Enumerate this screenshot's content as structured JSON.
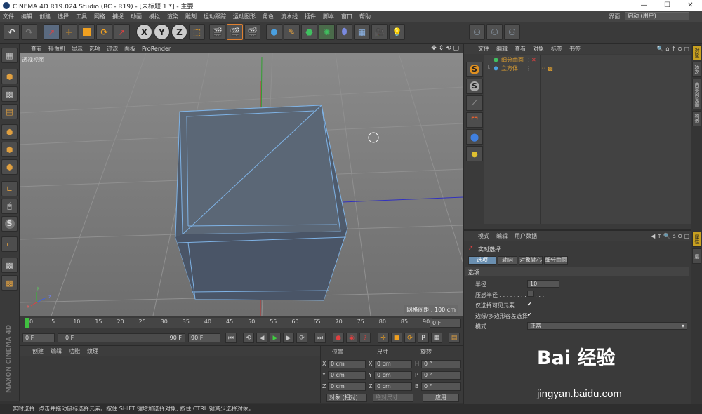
{
  "titlebar": {
    "title": "CINEMA 4D R19.024 Studio (RC - R19) - [未标题 1 *] - 主要",
    "min": "—",
    "max": "☐",
    "close": "✕"
  },
  "menubar": {
    "items": [
      "文件",
      "编辑",
      "创建",
      "选择",
      "工具",
      "网格",
      "捕捉",
      "动画",
      "模拟",
      "渲染",
      "雕刻",
      "运动跟踪",
      "运动图形",
      "角色",
      "流水线",
      "插件",
      "脚本",
      "窗口",
      "帮助"
    ],
    "layout_label": "界面:",
    "layout_value": "启动 (用户)"
  },
  "toolbar": {
    "axis_x": "X",
    "axis_y": "Y",
    "axis_z": "Z"
  },
  "viewport": {
    "menu": [
      "查看",
      "摄像机",
      "显示",
      "选项",
      "过滤",
      "面板",
      "ProRender"
    ],
    "label": "透视视图",
    "grid_spacing": "网格间距 : 100 cm",
    "axis_y": "y",
    "axis_z": "z",
    "axis_x": "x"
  },
  "timeline": {
    "ticks": [
      "0",
      "5",
      "10",
      "15",
      "20",
      "25",
      "30",
      "35",
      "40",
      "45",
      "50",
      "55",
      "60",
      "65",
      "70",
      "75",
      "80",
      "85",
      "90"
    ],
    "current_frame": "0 F"
  },
  "transport": {
    "start": "0 F",
    "range_start": "0 F",
    "range_end": "90 F",
    "end": "90 F"
  },
  "material": {
    "menu": [
      "创建",
      "编辑",
      "功能",
      "纹理"
    ]
  },
  "coords": {
    "headers": [
      "位置",
      "尺寸",
      "旋转"
    ],
    "rows": [
      {
        "axis": "X",
        "pos": "0 cm",
        "size_axis": "X",
        "size": "0 cm",
        "rot_axis": "H",
        "rot": "0 °"
      },
      {
        "axis": "Y",
        "pos": "0 cm",
        "size_axis": "Y",
        "size": "0 cm",
        "rot_axis": "P",
        "rot": "0 °"
      },
      {
        "axis": "Z",
        "pos": "0 cm",
        "size_axis": "Z",
        "size": "0 cm",
        "rot_axis": "B",
        "rot": "0 °"
      }
    ],
    "mode": "对象 (相对)",
    "size_mode": "绝对尺寸",
    "apply": "应用"
  },
  "objects": {
    "menu": [
      "文件",
      "编辑",
      "查看",
      "对象",
      "标签",
      "书签"
    ],
    "items": [
      {
        "name": "细分曲面",
        "color": "#e0a030"
      },
      {
        "name": "立方体",
        "color": "#e0a030"
      }
    ]
  },
  "attributes": {
    "menu": [
      "模式",
      "编辑",
      "用户数据"
    ],
    "tool_title": "实时选择",
    "tabs": [
      "选项",
      "轴向",
      "对象轴心",
      "细分曲面"
    ],
    "section": "选项",
    "rows": [
      {
        "label": "半径 . . . . . . . . . . . . . . .",
        "value": "10"
      },
      {
        "label": "压感半径 . . . . . . . . . . . . .",
        "value": ""
      },
      {
        "label": "仅选择可见元素 . . . . . . . . . .",
        "value": "✔"
      },
      {
        "label": "边缘/多边形容差选择",
        "value": "✔"
      },
      {
        "label": "模式 . . . . . . . . . . . . . . .",
        "value": "正常"
      }
    ]
  },
  "sidetabs": [
    "对象",
    "场次",
    "内容浏览器",
    "构造"
  ],
  "sidetabs2": [
    "属性",
    "层"
  ],
  "status": "实时选择: 点击并拖动鼠标选择元素。按住 SHIFT 键增加选择对象; 按住 CTRL 键减少选择对象。",
  "maxon": "MAXON CINEMA 4D",
  "watermark": {
    "brand": "Bai 经验",
    "url": "jingyan.baidu.com"
  }
}
